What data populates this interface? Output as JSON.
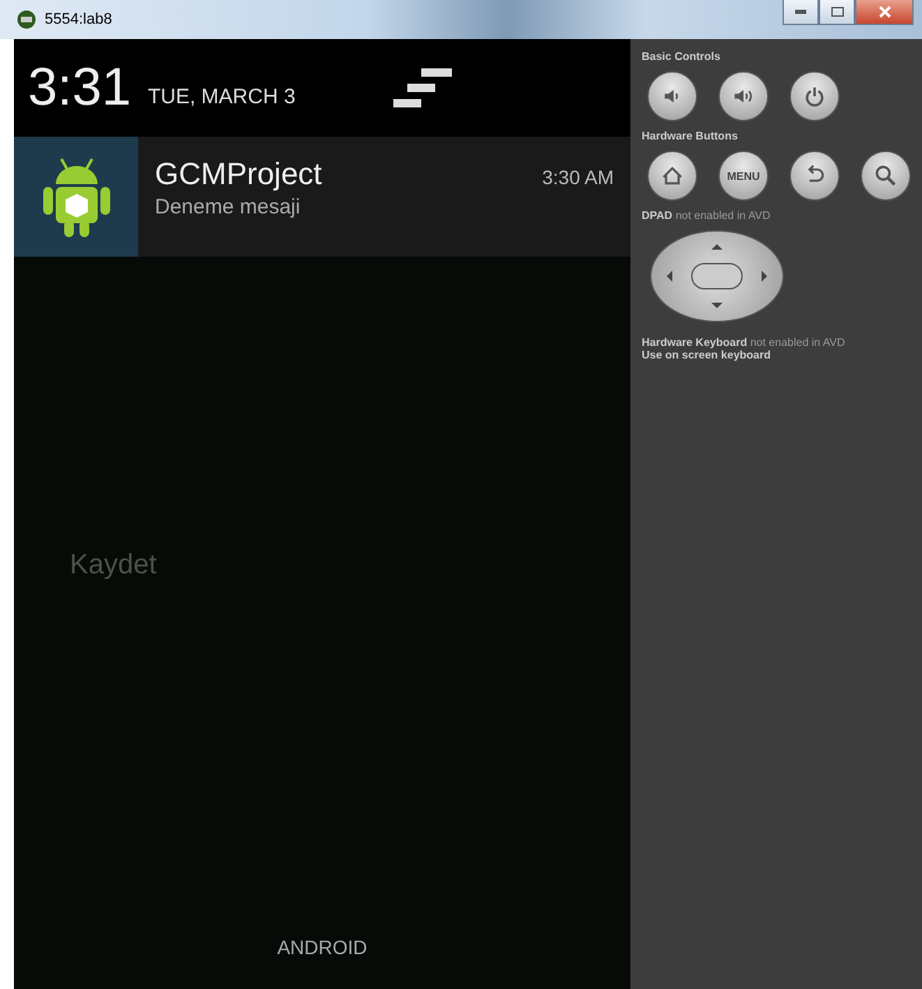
{
  "window": {
    "title": "5554:lab8"
  },
  "status_header": {
    "time": "3:31",
    "date": "TUE, MARCH 3"
  },
  "notifications": [
    {
      "title": "GCMProject",
      "text": "Deneme mesaji",
      "time": "3:30 AM"
    }
  ],
  "background_app": {
    "button": "Kaydet"
  },
  "footer": {
    "carrier": "ANDROID"
  },
  "controls": {
    "sections": [
      {
        "title": "Basic Controls",
        "buttons": [
          {
            "kind": "volume-down"
          },
          {
            "kind": "volume-up"
          },
          {
            "kind": "power"
          }
        ]
      },
      {
        "title": "Hardware Buttons",
        "buttons": [
          {
            "kind": "home"
          },
          {
            "kind": "menu",
            "label": "MENU"
          },
          {
            "kind": "back"
          },
          {
            "kind": "search"
          }
        ]
      }
    ],
    "dpad_title": "DPAD",
    "dpad_note": "not enabled in AVD",
    "keyboard_title": "Hardware Keyboard",
    "keyboard_note": "not enabled in AVD",
    "keyboard_hint": "Use on screen keyboard"
  }
}
